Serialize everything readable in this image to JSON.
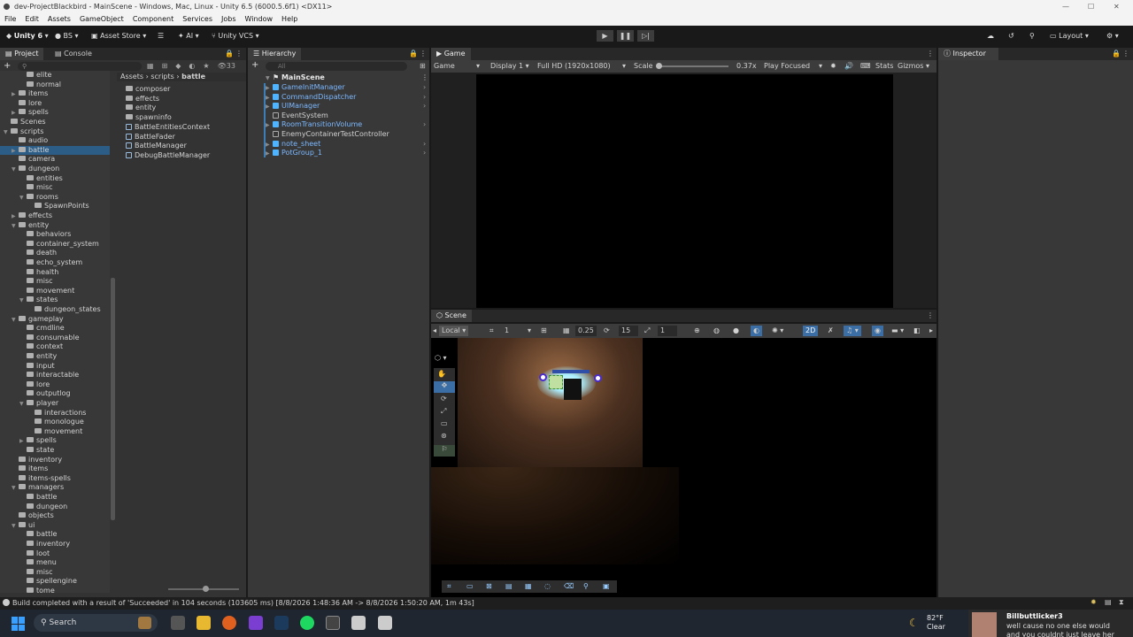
{
  "window": {
    "title": "dev-ProjectBlackbird - MainScene - Windows, Mac, Linux - Unity 6.5 (6000.5.6f1) <DX11>"
  },
  "menu": [
    "File",
    "Edit",
    "Assets",
    "GameObject",
    "Component",
    "Services",
    "Jobs",
    "Window",
    "Help"
  ],
  "toolbar": {
    "unity": "Unity 6",
    "account": "BS",
    "asset_store": "Asset Store",
    "ai": "AI",
    "vcs": "Unity VCS",
    "layout": "Layout"
  },
  "project": {
    "tabs": [
      "Project",
      "Console"
    ],
    "count": "33",
    "breadcrumb": [
      "Assets",
      "scripts",
      "battle"
    ],
    "tree": [
      {
        "label": "elite",
        "indent": 3
      },
      {
        "label": "normal",
        "indent": 3
      },
      {
        "label": "items",
        "indent": 2
      },
      {
        "label": "lore",
        "indent": 2
      },
      {
        "label": "spells",
        "indent": 2
      },
      {
        "label": "Scenes",
        "indent": 1
      },
      {
        "label": "scripts",
        "indent": 1
      },
      {
        "label": "audio",
        "indent": 2
      },
      {
        "label": "battle",
        "indent": 2
      },
      {
        "label": "camera",
        "indent": 2
      },
      {
        "label": "dungeon",
        "indent": 2
      },
      {
        "label": "entities",
        "indent": 3
      },
      {
        "label": "misc",
        "indent": 3
      },
      {
        "label": "rooms",
        "indent": 3
      },
      {
        "label": "SpawnPoints",
        "indent": 4
      },
      {
        "label": "effects",
        "indent": 2
      },
      {
        "label": "entity",
        "indent": 2
      },
      {
        "label": "behaviors",
        "indent": 3
      },
      {
        "label": "container_system",
        "indent": 3
      },
      {
        "label": "death",
        "indent": 3
      },
      {
        "label": "echo_system",
        "indent": 3
      },
      {
        "label": "health",
        "indent": 3
      },
      {
        "label": "misc",
        "indent": 3
      },
      {
        "label": "movement",
        "indent": 3
      },
      {
        "label": "states",
        "indent": 3
      },
      {
        "label": "dungeon_states",
        "indent": 4
      },
      {
        "label": "gameplay",
        "indent": 2
      },
      {
        "label": "cmdline",
        "indent": 3
      },
      {
        "label": "consumable",
        "indent": 3
      },
      {
        "label": "context",
        "indent": 3
      },
      {
        "label": "entity",
        "indent": 3
      },
      {
        "label": "input",
        "indent": 3
      },
      {
        "label": "interactable",
        "indent": 3
      },
      {
        "label": "lore",
        "indent": 3
      },
      {
        "label": "outputlog",
        "indent": 3
      },
      {
        "label": "player",
        "indent": 3
      },
      {
        "label": "interactions",
        "indent": 4
      },
      {
        "label": "monologue",
        "indent": 4
      },
      {
        "label": "movement",
        "indent": 4
      },
      {
        "label": "spells",
        "indent": 3
      },
      {
        "label": "state",
        "indent": 3
      },
      {
        "label": "inventory",
        "indent": 2
      },
      {
        "label": "items",
        "indent": 2
      },
      {
        "label": "items-spells",
        "indent": 2
      },
      {
        "label": "managers",
        "indent": 2
      },
      {
        "label": "battle",
        "indent": 3
      },
      {
        "label": "dungeon",
        "indent": 3
      },
      {
        "label": "objects",
        "indent": 2
      },
      {
        "label": "ui",
        "indent": 2
      },
      {
        "label": "battle",
        "indent": 3
      },
      {
        "label": "inventory",
        "indent": 3
      },
      {
        "label": "loot",
        "indent": 3
      },
      {
        "label": "menu",
        "indent": 3
      },
      {
        "label": "misc",
        "indent": 3
      },
      {
        "label": "spellengine",
        "indent": 3
      },
      {
        "label": "tome",
        "indent": 3
      }
    ],
    "assets": [
      "composer",
      "effects",
      "entity",
      "spawninfo",
      "BattleEntitiesContext",
      "BattleFader",
      "BattleManager",
      "DebugBattleManager"
    ]
  },
  "hierarchy": {
    "tab": "Hierarchy",
    "search_placeholder": "All",
    "scene": "MainScene",
    "items": [
      {
        "label": "GameInitManager",
        "prefab": true
      },
      {
        "label": "CommandDispatcher",
        "prefab": true
      },
      {
        "label": "UIManager",
        "prefab": true
      },
      {
        "label": "EventSystem",
        "prefab": false
      },
      {
        "label": "RoomTransitionVolume",
        "prefab": true
      },
      {
        "label": "EnemyContainerTestController",
        "prefab": false
      },
      {
        "label": "note_sheet",
        "prefab": true
      },
      {
        "label": "PotGroup_1",
        "prefab": true
      }
    ]
  },
  "game": {
    "tab": "Game",
    "mode": "Game",
    "display": "Display 1",
    "resolution": "Full HD (1920x1080)",
    "scale_label": "Scale",
    "scale": "0.37x",
    "play_focused": "Play Focused",
    "stats": "Stats",
    "gizmos": "Gizmos"
  },
  "scene": {
    "tab": "Scene",
    "pivot": "Local",
    "snap": "1",
    "grid_size": "0.25",
    "rotate": "15",
    "scale_snap": "1",
    "mode2d": "2D"
  },
  "inspector": {
    "tab": "Inspector"
  },
  "status": {
    "text": "Build completed with a result of 'Succeeded' in 104 seconds (103605 ms) [8/8/2026 1:48:36 AM -> 8/8/2026 1:50:20 AM, 1m 43s]"
  },
  "taskbar": {
    "search": "Search",
    "temp": "82°F",
    "weather": "Clear",
    "chat_user": "Billbuttlicker3",
    "chat_line1": "well cause no one else would",
    "chat_line2": "and you couldnt just leave her"
  }
}
